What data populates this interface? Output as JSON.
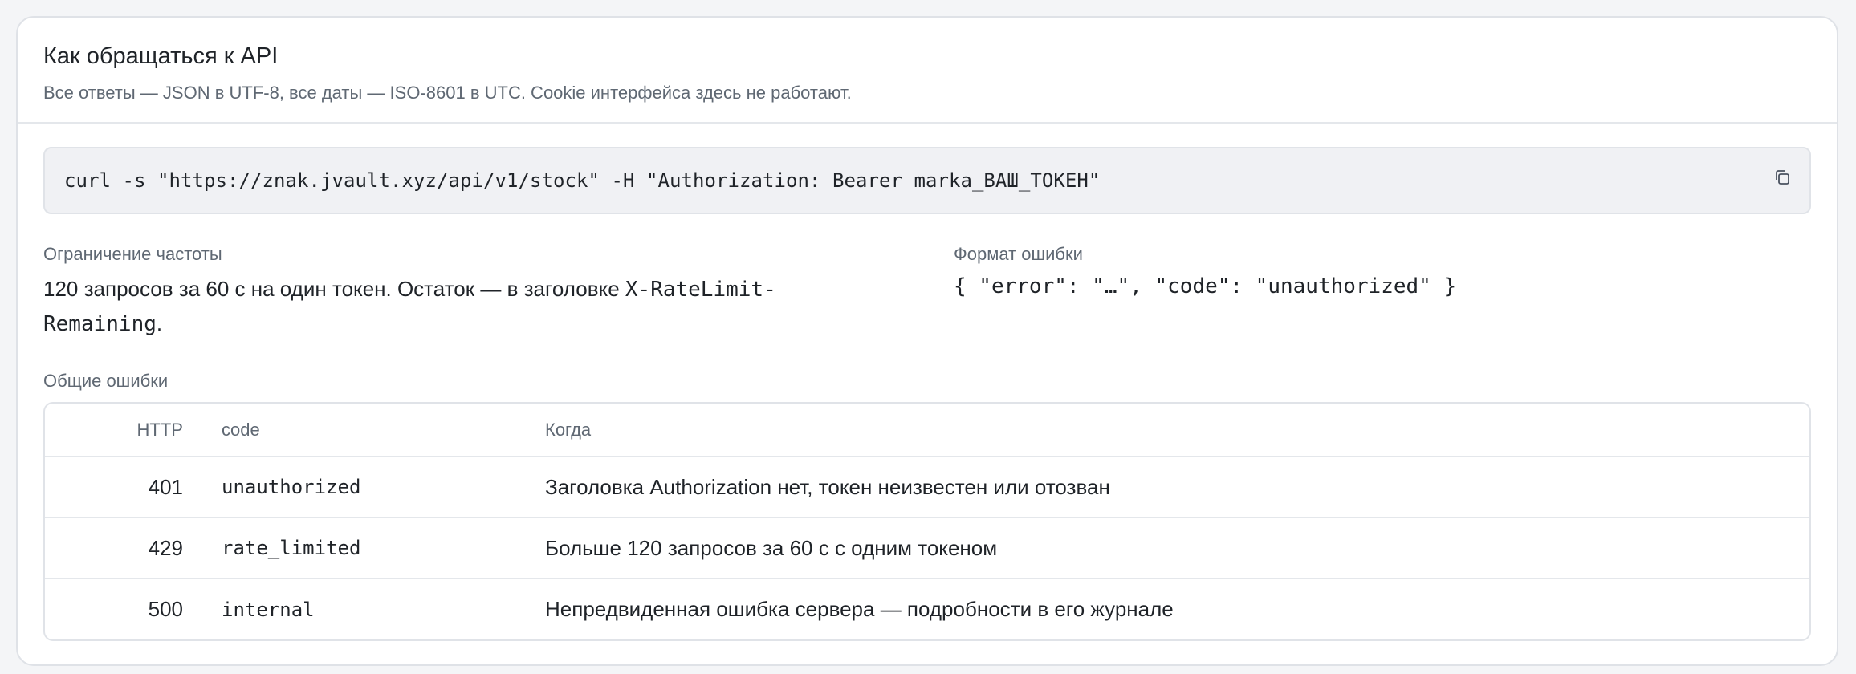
{
  "header": {
    "title": "Как обращаться к API",
    "subtitle": "Все ответы — JSON в UTF-8, все даты — ISO-8601 в UTC. Cookie интерфейса здесь не работают."
  },
  "code_example": {
    "command": "curl -s \"https://znak.jvault.xyz/api/v1/stock\" -H \"Authorization: Bearer marka_ВАШ_ТОКЕН\"",
    "copy_icon": "copy-icon"
  },
  "rate_limit": {
    "label": "Ограничение частоты",
    "text_before": "120 запросов за 60 с на один токен. Остаток — в заголовке ",
    "header_name": "X-RateLimit-Remaining",
    "text_after": "."
  },
  "error_format": {
    "label": "Формат ошибки",
    "example": "{ \"error\": \"…\", \"code\": \"unauthorized\" }"
  },
  "errors_table": {
    "label": "Общие ошибки",
    "columns": {
      "http": "HTTP",
      "code": "code",
      "when": "Когда"
    },
    "rows": [
      {
        "http": "401",
        "code": "unauthorized",
        "when": "Заголовка Authorization нет, токен неизвестен или отозван"
      },
      {
        "http": "429",
        "code": "rate_limited",
        "when": "Больше 120 запросов за 60 с с одним токеном"
      },
      {
        "http": "500",
        "code": "internal",
        "when": "Непредвиденная ошибка сервера — подробности в его журнале"
      }
    ]
  }
}
